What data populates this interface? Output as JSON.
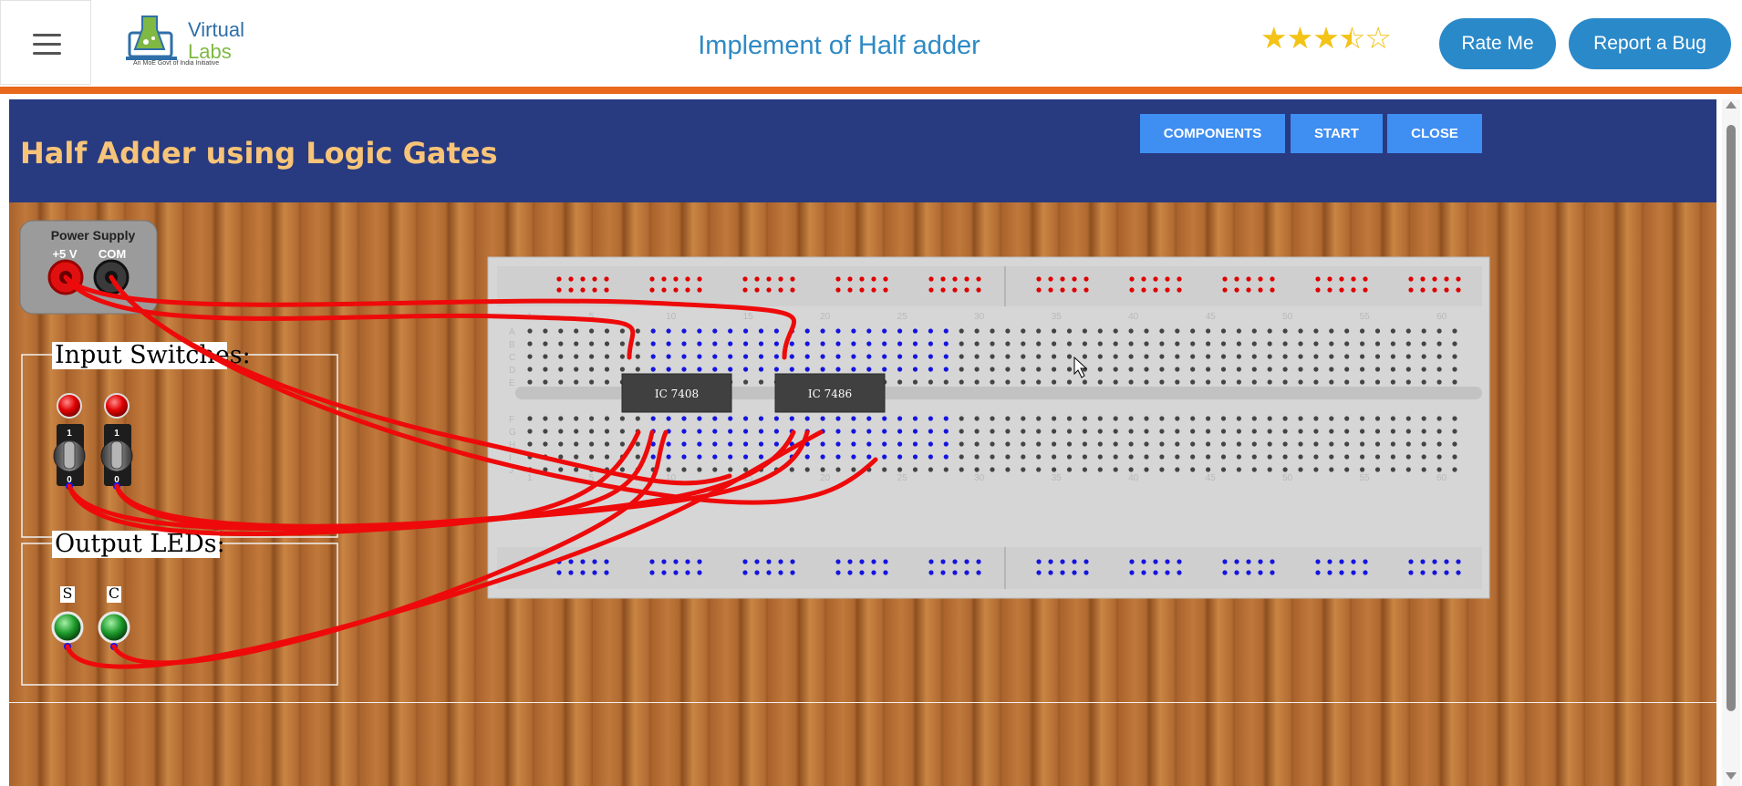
{
  "app": {
    "title": "Implement of Half adder",
    "logo": {
      "line1": "Virtual",
      "line2": "Labs",
      "tagline": "An MoE Govt of India Initiative"
    },
    "rating": {
      "value": 3.5,
      "max": 5
    },
    "rate_label": "Rate Me",
    "bug_label": "Report a Bug"
  },
  "sim": {
    "title": "Half Adder using Logic Gates",
    "buttons": {
      "components": "COMPONENTS",
      "start": "START",
      "close": "CLOSE"
    },
    "power_supply": {
      "title": "Power Supply",
      "plus": "+5 V",
      "com": "COM"
    },
    "inputs_label": "Input Switches:",
    "switch_marks": {
      "on": "1",
      "off": "0"
    },
    "outputs_label": "Output LEDs:",
    "leds": [
      "S",
      "C"
    ],
    "ics": [
      "IC 7408",
      "IC 7486"
    ],
    "row_letters_top": [
      "A",
      "B",
      "C",
      "D",
      "E"
    ],
    "row_letters_bottom": [
      "F",
      "G",
      "H",
      "I",
      "J"
    ],
    "column_numbers": [
      "1",
      "5",
      "10",
      "15",
      "20",
      "25",
      "30",
      "35",
      "40",
      "45",
      "50",
      "55",
      "60"
    ]
  },
  "colors": {
    "accent": "#2a89c9",
    "header": "#283a80",
    "wire": "#ee0a0a",
    "title": "#f7c478",
    "orange": "#e8681c"
  }
}
